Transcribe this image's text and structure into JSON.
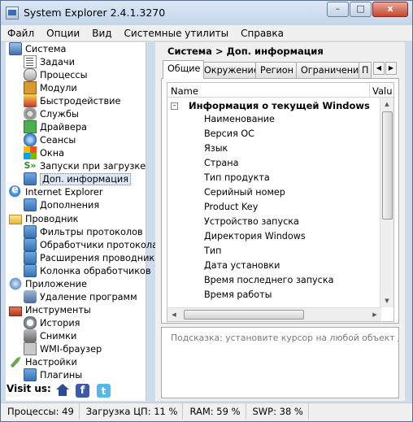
{
  "window": {
    "title": "System Explorer 2.4.1.3270",
    "buttons": {
      "minimize": "–",
      "maximize": "□",
      "close": "x"
    }
  },
  "menu": [
    "Файл",
    "Опции",
    "Вид",
    "Системные утилиты",
    "Справка"
  ],
  "sidebar": {
    "categories": [
      {
        "label": "Система",
        "icon": "system-icon",
        "items": [
          {
            "label": "Задачи",
            "icon": "tasks-icon"
          },
          {
            "label": "Процессы",
            "icon": "processes-icon"
          },
          {
            "label": "Модули",
            "icon": "modules-icon"
          },
          {
            "label": "Быстродействие",
            "icon": "performance-icon"
          },
          {
            "label": "Службы",
            "icon": "services-icon"
          },
          {
            "label": "Драйвера",
            "icon": "drivers-icon"
          },
          {
            "label": "Сеансы",
            "icon": "sessions-icon"
          },
          {
            "label": "Окна",
            "icon": "windows-icon"
          },
          {
            "label": "Запуски при загрузке",
            "icon": "startup-icon"
          },
          {
            "label": "Доп. информация",
            "icon": "puzzle-icon",
            "selected": true
          }
        ]
      },
      {
        "label": "Internet Explorer",
        "icon": "ie-icon",
        "items": [
          {
            "label": "Дополнения",
            "icon": "puzzle-icon"
          }
        ]
      },
      {
        "label": "Проводник",
        "icon": "folder-icon",
        "items": [
          {
            "label": "Фильтры протоколов",
            "icon": "puzzle-icon"
          },
          {
            "label": "Обработчики протокола",
            "icon": "puzzle-icon"
          },
          {
            "label": "Расширения проводника",
            "icon": "puzzle-icon"
          },
          {
            "label": "Колонка обработчиков",
            "icon": "puzzle-icon"
          }
        ]
      },
      {
        "label": "Приложение",
        "icon": "application-icon",
        "items": [
          {
            "label": "Удаление программ",
            "icon": "uninstall-icon"
          }
        ]
      },
      {
        "label": "Инструменты",
        "icon": "toolbox-icon",
        "items": [
          {
            "label": "История",
            "icon": "history-icon"
          },
          {
            "label": "Снимки",
            "icon": "snapshot-icon"
          },
          {
            "label": "WMI-браузер",
            "icon": "wmi-icon"
          }
        ]
      },
      {
        "label": "Настройки",
        "icon": "settings-icon",
        "items": [
          {
            "label": "Плагины",
            "icon": "puzzle-icon"
          }
        ]
      }
    ],
    "visit_label": "Visit us:",
    "social": {
      "facebook": "f",
      "twitter": "t"
    }
  },
  "main": {
    "breadcrumb": "Система > Доп. информация",
    "tabs": [
      "Общие",
      "Окружение",
      "Регион",
      "Ограничения",
      "П"
    ],
    "columns": {
      "name": "Name",
      "value": "Valu"
    },
    "group": {
      "expander": "–",
      "title": "Информация о текущей Windows"
    },
    "properties": [
      "Наименование",
      "Версия ОС",
      "Язык",
      "Страна",
      "Тип продукта",
      "Серийный номер",
      "Product Key",
      "Устройство запуска",
      "Директория Windows",
      "Тип",
      "Дата установки",
      "Время последнего запуска",
      "Время работы"
    ],
    "hint": "Подсказка: установите курсор на любой объект для по"
  },
  "status": {
    "processes": "Процессы: 49",
    "cpu": "Загрузка ЦП: 11 %",
    "ram": "RAM: 59 %",
    "swap": "SWP: 38 %"
  }
}
